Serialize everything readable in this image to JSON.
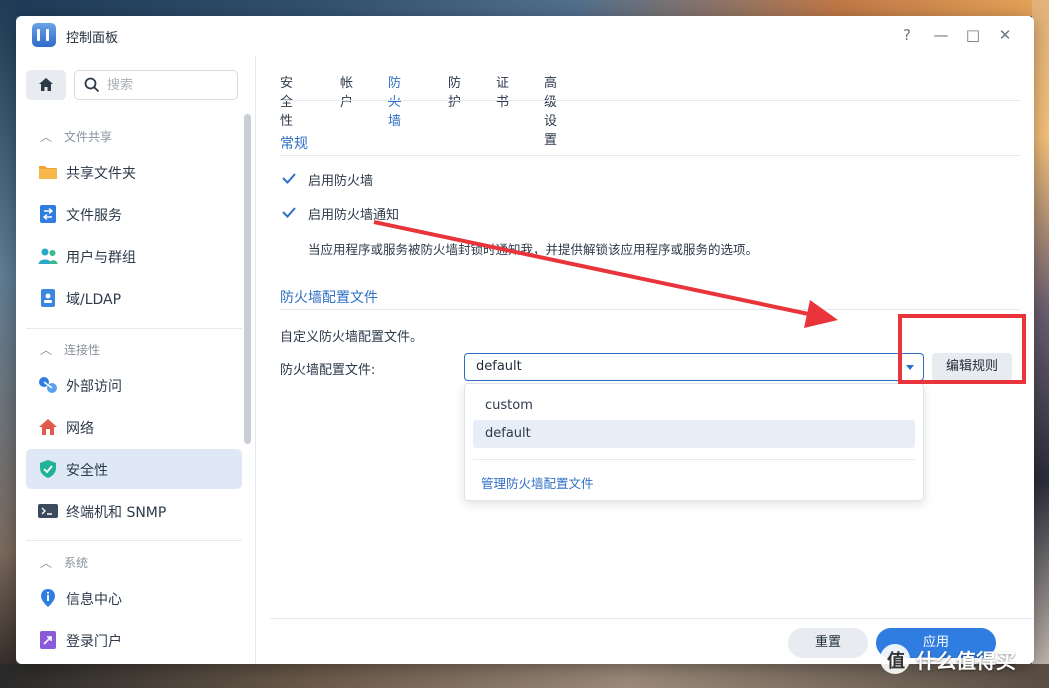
{
  "window": {
    "title": "控制面板"
  },
  "window_controls": {
    "help": "?",
    "minimize": "—",
    "maximize": "□",
    "close": "✕"
  },
  "sidebar": {
    "search_placeholder": "搜索",
    "groups": [
      {
        "label": "文件共享",
        "items": [
          {
            "label": "共享文件夹",
            "icon": "folder-share-icon"
          },
          {
            "label": "文件服务",
            "icon": "file-services-icon"
          },
          {
            "label": "用户与群组",
            "icon": "users-groups-icon"
          },
          {
            "label": "域/LDAP",
            "icon": "domain-ldap-icon"
          }
        ]
      },
      {
        "label": "连接性",
        "items": [
          {
            "label": "外部访问",
            "icon": "external-access-icon"
          },
          {
            "label": "网络",
            "icon": "network-icon"
          },
          {
            "label": "安全性",
            "icon": "security-shield-icon",
            "active": true
          },
          {
            "label": "终端机和 SNMP",
            "icon": "terminal-icon"
          }
        ]
      },
      {
        "label": "系统",
        "items": [
          {
            "label": "信息中心",
            "icon": "info-center-icon"
          },
          {
            "label": "登录门户",
            "icon": "login-portal-icon"
          }
        ]
      }
    ]
  },
  "tabs": [
    {
      "label": "安全性"
    },
    {
      "label": "帐户"
    },
    {
      "label": "防火墙",
      "active": true
    },
    {
      "label": "防护"
    },
    {
      "label": "证书"
    },
    {
      "label": "高级设置"
    }
  ],
  "general": {
    "title": "常规",
    "enable_firewall": {
      "label": "启用防火墙",
      "checked": true
    },
    "enable_notification": {
      "label": "启用防火墙通知",
      "checked": true
    },
    "hint": "当应用程序或服务被防火墙封锁时通知我，并提供解锁该应用程序或服务的选项。"
  },
  "profile": {
    "title": "防火墙配置文件",
    "description": "自定义防火墙配置文件。",
    "field_label": "防火墙配置文件:",
    "selected": "default",
    "options": [
      "custom",
      "default"
    ],
    "manage_link": "管理防火墙配置文件",
    "edit_rules_button": "编辑规则"
  },
  "footer": {
    "reset": "重置",
    "apply": "应用"
  },
  "watermark": {
    "badge": "值",
    "text": "什么值得买"
  },
  "colors": {
    "accent": "#2f6fc6",
    "apply_button": "#2f7de0",
    "annotation": "#e8343a"
  }
}
